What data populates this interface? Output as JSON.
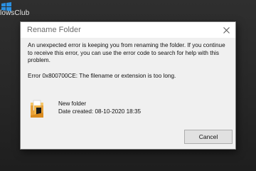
{
  "desktop": {
    "brand_text": "lowsClub"
  },
  "dialog": {
    "title": "Rename Folder",
    "message": "An unexpected error is keeping you from renaming the folder. If you continue to receive this error, you can use the error code to search for help with this problem.",
    "error_text": "Error 0x800700CE: The filename or extension is too long.",
    "file": {
      "name": "New folder",
      "date_label": "Date created:",
      "date_value": "08-10-2020 18:35"
    },
    "cancel_label": "Cancel",
    "icons": {
      "close": "close-icon",
      "folder": "folder-icon",
      "logo": "windows-logo-icon"
    }
  }
}
